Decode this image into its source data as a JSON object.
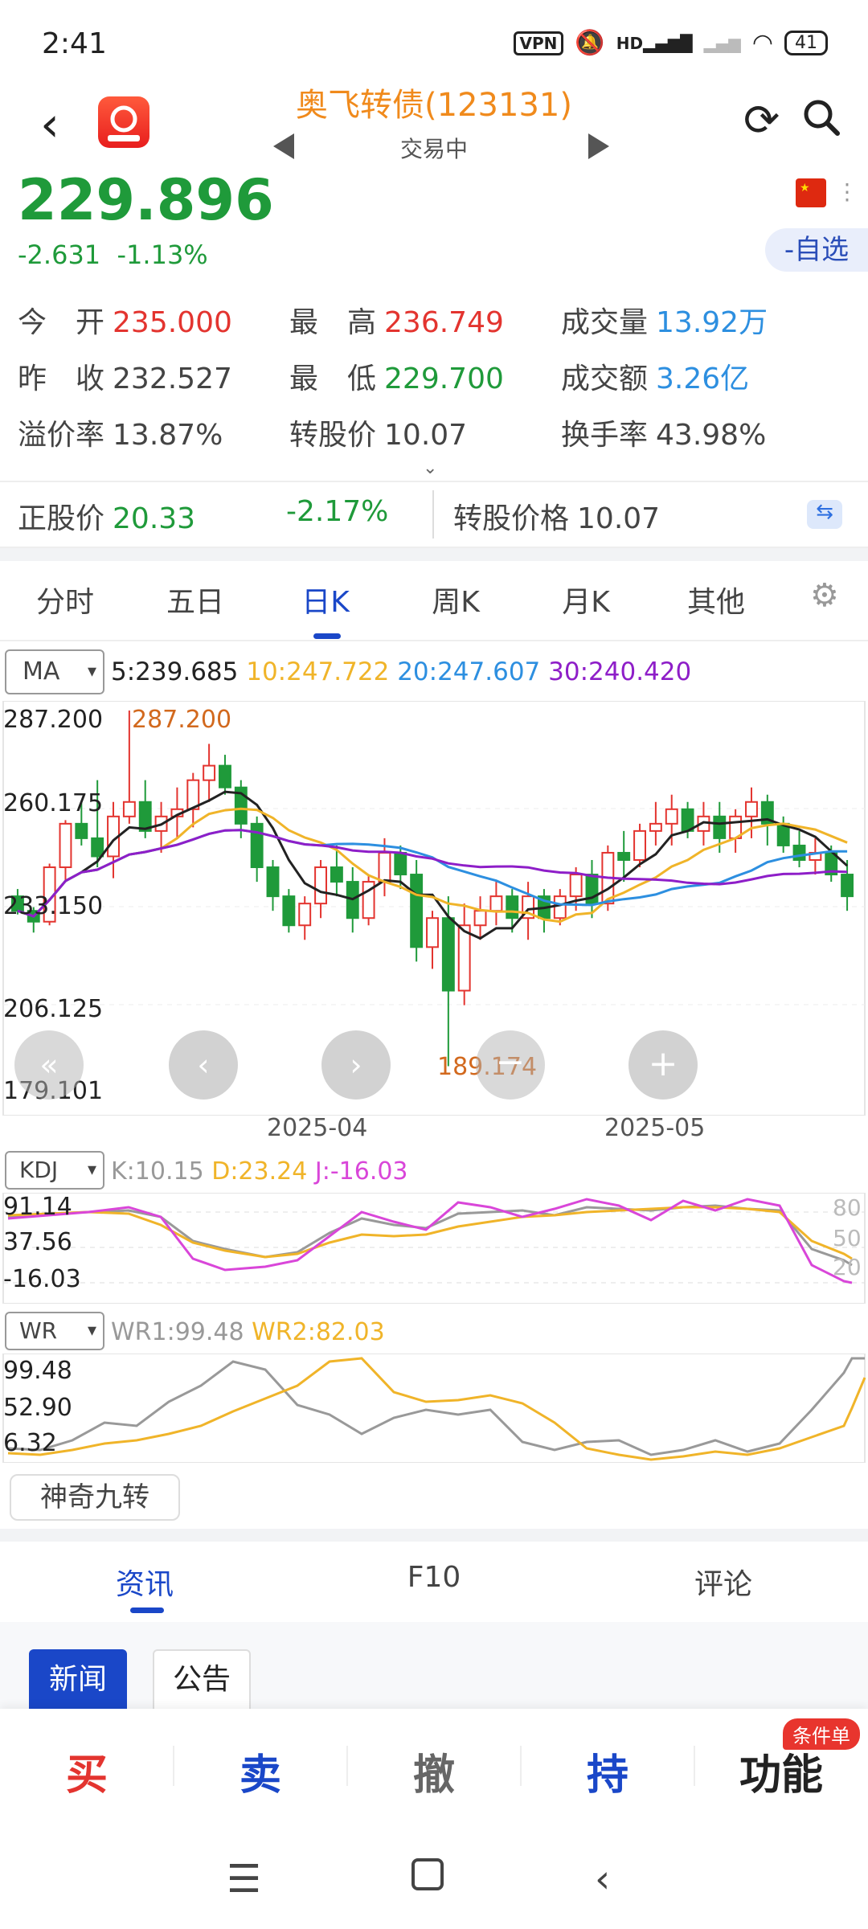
{
  "status": {
    "time": "2:41",
    "vpn": "VPN",
    "hd": "HD",
    "battery": "41"
  },
  "header": {
    "title": "奥飞转债(123131)",
    "subtitle": "交易中"
  },
  "quote": {
    "price": "229.896",
    "change": "-2.631",
    "change_pct": "-1.13%",
    "watch_btn": "-自选"
  },
  "stats": {
    "open_label": "今　开",
    "open": "235.000",
    "high_label": "最　高",
    "high": "236.749",
    "volume_label": "成交量",
    "volume": "13.92万",
    "prev_label": "昨　收",
    "prev": "232.527",
    "low_label": "最　低",
    "low": "229.700",
    "amount_label": "成交额",
    "amount": "3.26亿",
    "premium_label": "溢价率",
    "premium": "13.87%",
    "conv_label": "转股价",
    "conv": "10.07",
    "turnover_label": "换手率",
    "turnover": "43.98%"
  },
  "stockbar": {
    "label": "正股价",
    "price": "20.33",
    "pct": "-2.17%",
    "conv_label": "转股价格",
    "conv": "10.07"
  },
  "tabs": [
    "分时",
    "五日",
    "日K",
    "周K",
    "月K",
    "其他"
  ],
  "active_tab": "日K",
  "ma": {
    "select": "MA",
    "ma5": "5:239.685",
    "ma10": "10:247.722",
    "ma20": "20:247.607",
    "ma30": "30:240.420",
    "colors": {
      "ma5": "#222222",
      "ma10": "#f0b429",
      "ma20": "#2d8fe0",
      "ma30": "#8e1ec8"
    }
  },
  "chart_labels": {
    "y_top": "287.200",
    "y_upper": "260.175",
    "y_mid": "233.150",
    "y_lower": "206.125",
    "y_bottom": "179.101",
    "max_marker": "287.200",
    "min_marker": "189.174",
    "x_ticks": [
      "2025-04",
      "2025-05"
    ]
  },
  "kdj": {
    "select": "KDJ",
    "k": "K:10.15",
    "d": "D:23.24",
    "j": "J:-16.03",
    "y": [
      "91.14",
      "37.56",
      "-16.03"
    ],
    "levels": [
      "80",
      "50",
      "20"
    ]
  },
  "wr": {
    "select": "WR",
    "wr1": "WR1:99.48",
    "wr2": "WR2:82.03",
    "y": [
      "99.48",
      "52.90",
      "6.32"
    ]
  },
  "magic_btn": "神奇九转",
  "bottom_tabs": [
    "资讯",
    "F10",
    "评论"
  ],
  "subtabs": {
    "news": "新闻",
    "ann": "公告"
  },
  "actions": {
    "buy": "买",
    "sell": "卖",
    "cancel": "撤",
    "hold": "持",
    "func": "功能",
    "badge": "条件单"
  },
  "chart_data": {
    "type": "candlestick",
    "ylim": [
      179.101,
      287.2
    ],
    "x_ticks": [
      "2025-04",
      "2025-05"
    ],
    "candles": [
      [
        236,
        238,
        231,
        232
      ],
      [
        232,
        233,
        226,
        229
      ],
      [
        229,
        245,
        228,
        244
      ],
      [
        244,
        257,
        240,
        256
      ],
      [
        256,
        262,
        250,
        252
      ],
      [
        252,
        268,
        244,
        247
      ],
      [
        247,
        262,
        241,
        258
      ],
      [
        258,
        287.2,
        256,
        262
      ],
      [
        262,
        268,
        252,
        254
      ],
      [
        254,
        262,
        248,
        258
      ],
      [
        258,
        266,
        252,
        260
      ],
      [
        260,
        270,
        255,
        268
      ],
      [
        268,
        278,
        262,
        272
      ],
      [
        272,
        275,
        264,
        266
      ],
      [
        266,
        268,
        252,
        256
      ],
      [
        256,
        258,
        240,
        244
      ],
      [
        244,
        246,
        232,
        236
      ],
      [
        236,
        238,
        226,
        228
      ],
      [
        228,
        236,
        224,
        234
      ],
      [
        234,
        246,
        230,
        244
      ],
      [
        244,
        250,
        236,
        240
      ],
      [
        240,
        244,
        226,
        230
      ],
      [
        230,
        242,
        228,
        240
      ],
      [
        240,
        252,
        236,
        248
      ],
      [
        248,
        250,
        238,
        242
      ],
      [
        242,
        246,
        218,
        222
      ],
      [
        222,
        232,
        216,
        230
      ],
      [
        230,
        236,
        189.174,
        210
      ],
      [
        210,
        234,
        206,
        228
      ],
      [
        228,
        236,
        224,
        232
      ],
      [
        232,
        240,
        228,
        236
      ],
      [
        236,
        238,
        226,
        230
      ],
      [
        230,
        240,
        224,
        236
      ],
      [
        236,
        238,
        226,
        230
      ],
      [
        230,
        238,
        228,
        236
      ],
      [
        236,
        244,
        232,
        242
      ],
      [
        242,
        246,
        230,
        234
      ],
      [
        234,
        250,
        232,
        248
      ],
      [
        248,
        254,
        240,
        246
      ],
      [
        246,
        256,
        244,
        254
      ],
      [
        254,
        262,
        250,
        256
      ],
      [
        256,
        264,
        250,
        260
      ],
      [
        260,
        262,
        252,
        254
      ],
      [
        254,
        262,
        250,
        258
      ],
      [
        258,
        262,
        248,
        252
      ],
      [
        252,
        260,
        248,
        258
      ],
      [
        258,
        266,
        252,
        262
      ],
      [
        262,
        264,
        250,
        256
      ],
      [
        256,
        258,
        248,
        250
      ],
      [
        250,
        254,
        244,
        246
      ],
      [
        246,
        252,
        242,
        248
      ],
      [
        248,
        250,
        240,
        242
      ],
      [
        242,
        246,
        232,
        236
      ]
    ]
  }
}
